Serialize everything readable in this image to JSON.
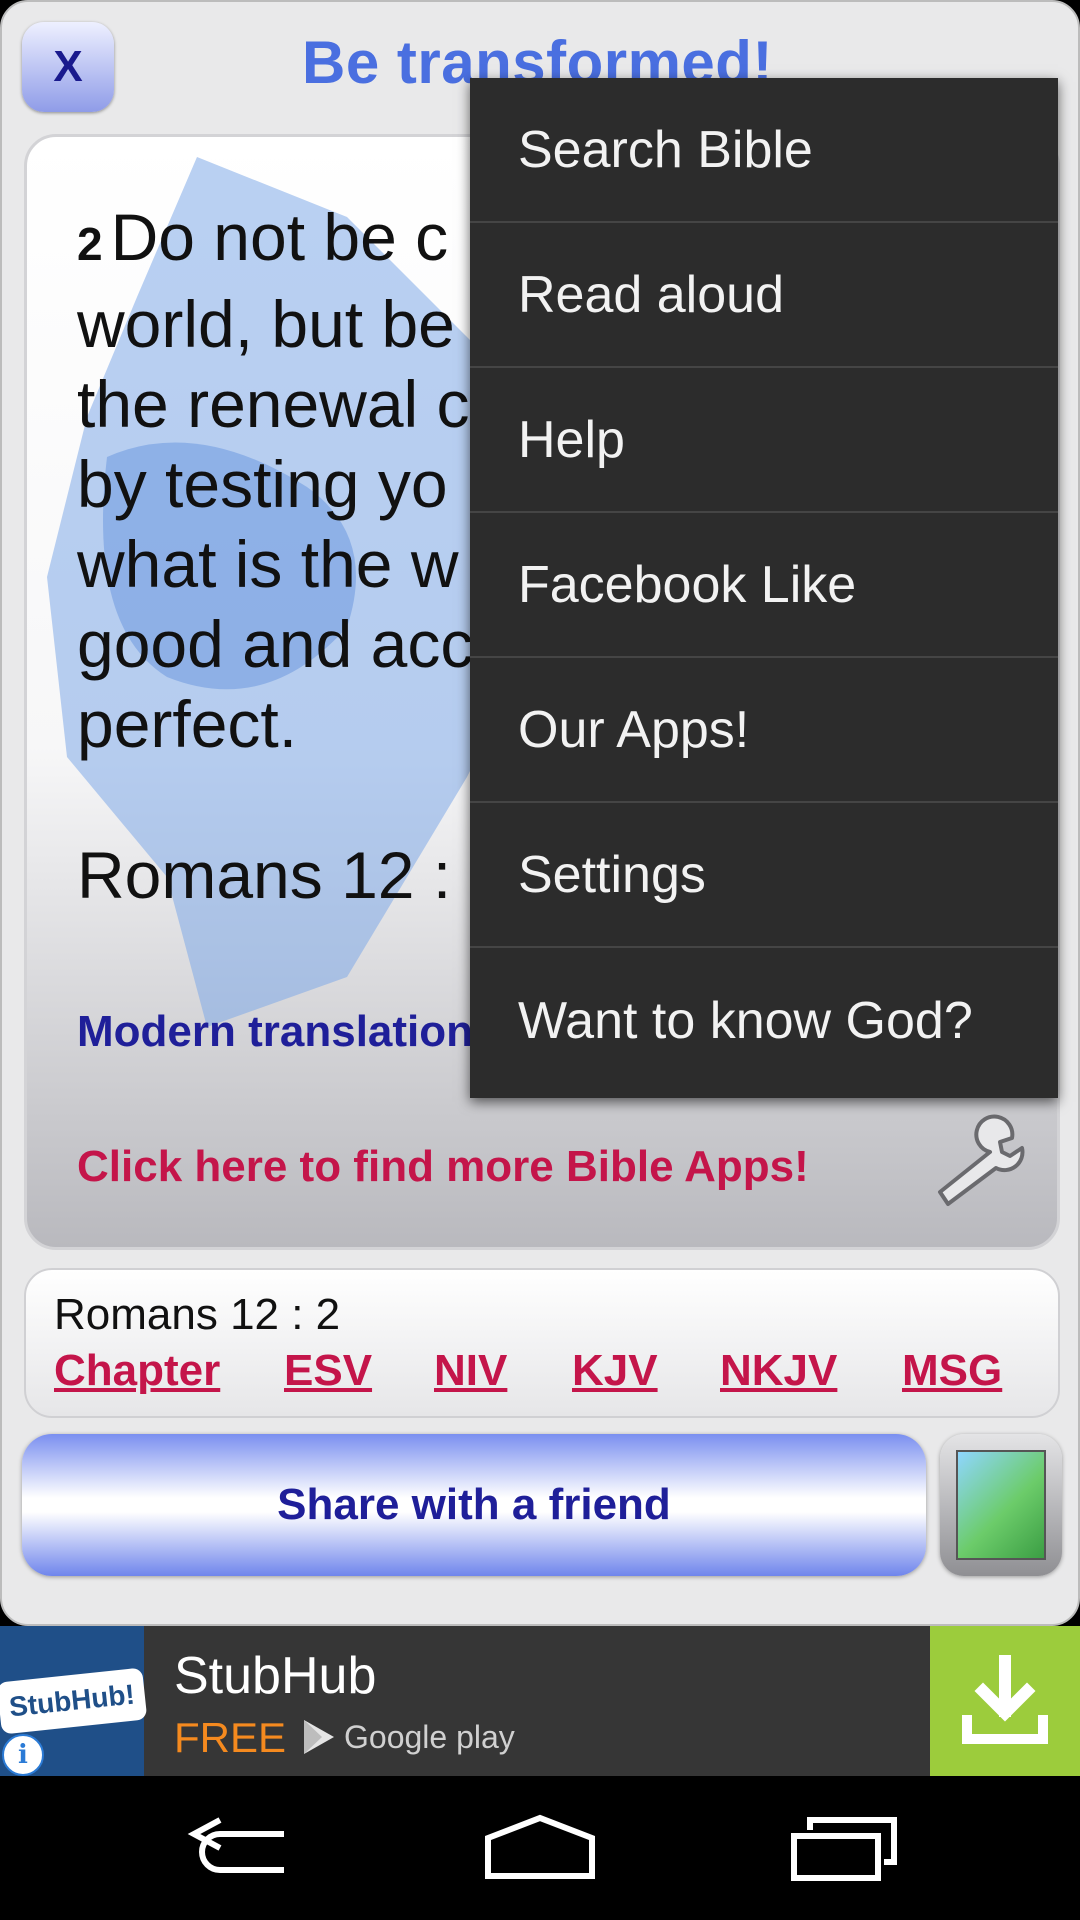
{
  "header": {
    "close_label": "X",
    "title": "Be transformed!"
  },
  "verse": {
    "number": "2",
    "lines": [
      "Do not be c",
      "world, but be",
      "the renewal c",
      "by testing yo",
      "what is the w",
      "good and acc",
      "perfect."
    ],
    "reference": "Romans 12 :",
    "translation_link": "Modern translation",
    "more_apps_link": "Click here to find more Bible Apps!"
  },
  "links_card": {
    "reference": "Romans 12 : 2",
    "links": [
      "Chapter",
      "ESV",
      "NIV",
      "KJV",
      "NKJV",
      "MSG"
    ]
  },
  "share": {
    "label": "Share with a friend"
  },
  "menu": {
    "items": [
      "Search Bible",
      "Read aloud",
      "Help",
      "Facebook Like",
      "Our Apps!",
      "Settings",
      "Want to know God?"
    ]
  },
  "ad": {
    "logo_text": "StubHub!",
    "title": "StubHub",
    "price": "FREE",
    "store": "Google play",
    "info_icon": "info-icon",
    "download_icon": "download-icon"
  },
  "navbar": {
    "icons": [
      "back-icon",
      "home-icon",
      "recents-icon"
    ]
  },
  "colors": {
    "accent_blue": "#4a6fe0",
    "link_red": "#c4154a",
    "dark_blue": "#1f1f99",
    "menu_bg": "#2c2c2c",
    "ad_green": "#9ccc3c"
  }
}
